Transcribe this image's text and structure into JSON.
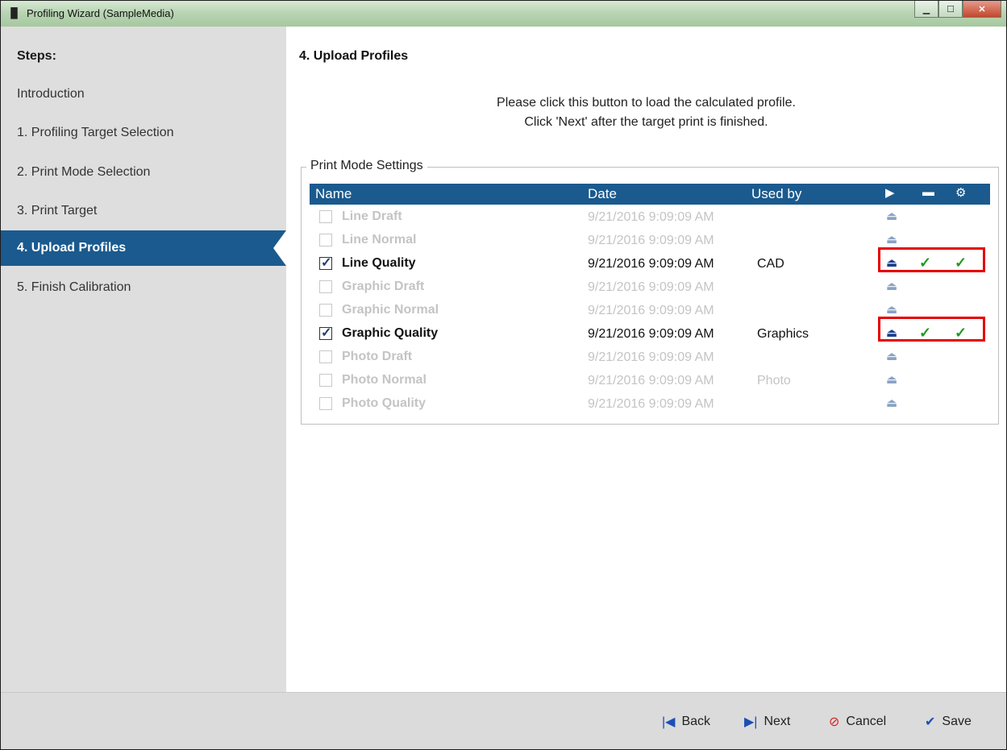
{
  "window": {
    "title": "Profiling Wizard (SampleMedia)",
    "app_icon": "wizard-icon",
    "controls": [
      "minimize",
      "maximize",
      "close"
    ]
  },
  "sidebar": {
    "title": "Steps:",
    "items": [
      {
        "label": "Introduction",
        "active": false
      },
      {
        "label": "1. Profiling Target Selection",
        "active": false
      },
      {
        "label": "2. Print Mode Selection",
        "active": false
      },
      {
        "label": "3. Print Target",
        "active": false
      },
      {
        "label": "4. Upload Profiles",
        "active": true
      },
      {
        "label": "5. Finish Calibration",
        "active": false
      }
    ]
  },
  "main": {
    "title": "4. Upload Profiles",
    "instructions": [
      "Please click this button to load the calculated profile.",
      "Click 'Next' after the target print is finished."
    ],
    "group_label": "Print Mode Settings",
    "table": {
      "headers": {
        "name": "Name",
        "date": "Date",
        "used_by": "Used by"
      },
      "header_icons": [
        "play-icon",
        "printer-icon",
        "settings-icon"
      ],
      "rows": [
        {
          "name": "Line Draft",
          "date": "9/21/2016 9:09:09 AM",
          "used_by": "",
          "checked": false,
          "enabled": false
        },
        {
          "name": "Line Normal",
          "date": "9/21/2016 9:09:09 AM",
          "used_by": "",
          "checked": false,
          "enabled": false
        },
        {
          "name": "Line Quality",
          "date": "9/21/2016 9:09:09 AM",
          "used_by": "CAD",
          "checked": true,
          "enabled": true
        },
        {
          "name": "Graphic Draft",
          "date": "9/21/2016 9:09:09 AM",
          "used_by": "",
          "checked": false,
          "enabled": false
        },
        {
          "name": "Graphic Normal",
          "date": "9/21/2016 9:09:09 AM",
          "used_by": "",
          "checked": false,
          "enabled": false
        },
        {
          "name": "Graphic Quality",
          "date": "9/21/2016 9:09:09 AM",
          "used_by": "Graphics",
          "checked": true,
          "enabled": true
        },
        {
          "name": "Photo Draft",
          "date": "9/21/2016 9:09:09 AM",
          "used_by": "",
          "checked": false,
          "enabled": false
        },
        {
          "name": "Photo Normal",
          "date": "9/21/2016 9:09:09 AM",
          "used_by": "Photo",
          "checked": false,
          "enabled": false
        },
        {
          "name": "Photo Quality",
          "date": "9/21/2016 9:09:09 AM",
          "used_by": "",
          "checked": false,
          "enabled": false
        }
      ]
    }
  },
  "footer": {
    "back": "Back",
    "next": "Next",
    "cancel": "Cancel",
    "save": "Save"
  },
  "colors": {
    "accent": "#1b5a8e",
    "highlight": "#e60000",
    "check_ok": "#1f9a1f"
  }
}
